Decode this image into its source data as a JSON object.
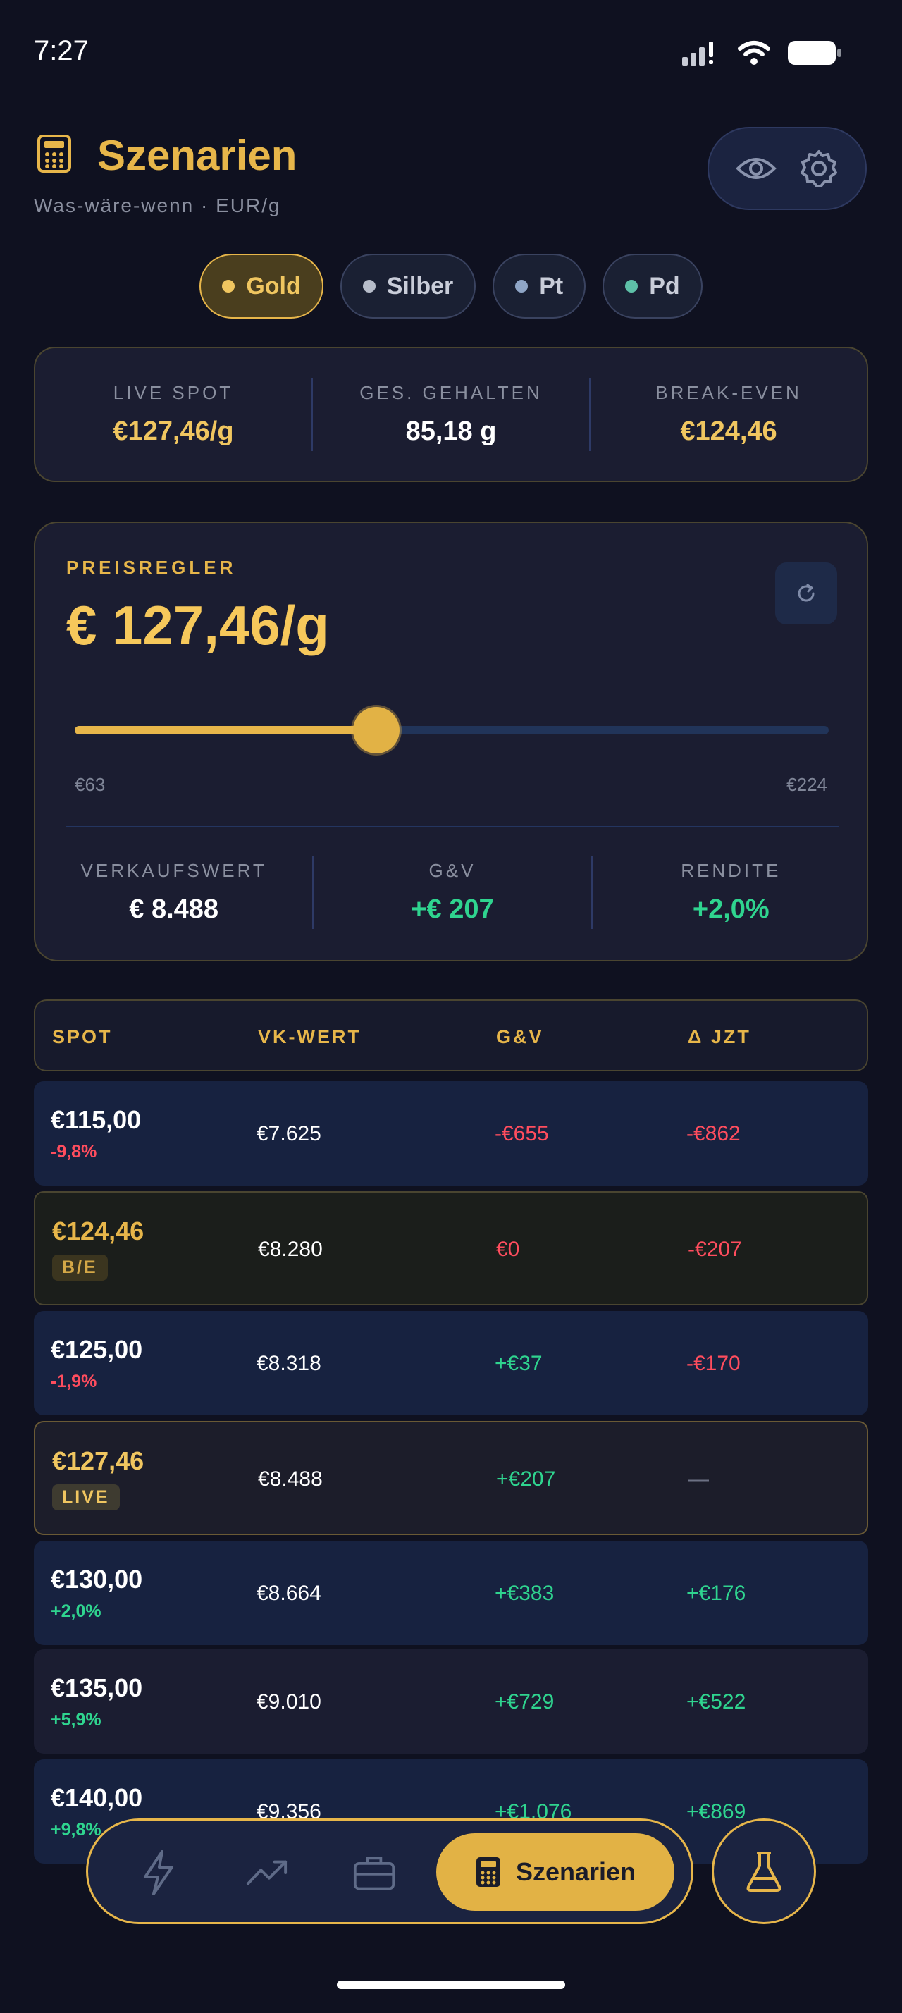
{
  "status": {
    "time": "7:27"
  },
  "header": {
    "title": "Szenarien",
    "subtitle": "Was-wäre-wenn  ·  EUR/g"
  },
  "metals": [
    {
      "label": "Gold",
      "dot": "#f0c660",
      "active": true
    },
    {
      "label": "Silber",
      "dot": "#b7bdca",
      "active": false
    },
    {
      "label": "Pt",
      "dot": "#8fa5c6",
      "active": false
    },
    {
      "label": "Pd",
      "dot": "#5ec0a8",
      "active": false
    }
  ],
  "summary": {
    "spot_label": "LIVE SPOT",
    "spot_value": "€127,46/g",
    "held_label": "GES. GEHALTEN",
    "held_value": "85,18 g",
    "be_label": "BREAK-EVEN",
    "be_value": "€124,46"
  },
  "slider": {
    "label": "PREISREGLER",
    "price": "€ 127,46/g",
    "min_label": "€63",
    "max_label": "€224",
    "position_fraction": 0.4
  },
  "metrics": {
    "sale_label": "VERKAUFSWERT",
    "sale_value": "€ 8.488",
    "pl_label": "G&V",
    "pl_value": "+€ 207",
    "ret_label": "RENDITE",
    "ret_value": "+2,0%"
  },
  "table": {
    "headers": {
      "spot": "SPOT",
      "vk": "VK-WERT",
      "gv": "G&V",
      "jzt": "Δ JZT"
    },
    "rows": [
      {
        "spot": "€115,00",
        "sub": "-9,8%",
        "vk": "€7.625",
        "gv": "-€655",
        "jzt": "-€862"
      },
      {
        "spot": "€124,46",
        "badge": "B/E",
        "vk": "€8.280",
        "gv": "€0",
        "jzt": "-€207"
      },
      {
        "spot": "€125,00",
        "sub": "-1,9%",
        "vk": "€8.318",
        "gv": "+€37",
        "jzt": "-€170"
      },
      {
        "spot": "€127,46",
        "badge": "LIVE",
        "vk": "€8.488",
        "gv": "+€207",
        "jzt": "—"
      },
      {
        "spot": "€130,00",
        "sub": "+2,0%",
        "vk": "€8.664",
        "gv": "+€383",
        "jzt": "+€176"
      },
      {
        "spot": "€135,00",
        "sub": "+5,9%",
        "vk": "€9.010",
        "gv": "+€729",
        "jzt": "+€522"
      },
      {
        "spot": "€140,00",
        "sub": "+9,8%",
        "vk": "€9.356",
        "gv": "+€1.076",
        "jzt": "+€869"
      }
    ]
  },
  "nav": {
    "items": [
      "bolt-icon",
      "trending-icon",
      "briefcase-icon"
    ],
    "active_label": "Szenarien"
  },
  "colors": {
    "accent": "#e7b64a",
    "positive": "#2fd48f",
    "negative": "#ff4d5e",
    "background": "#0f1120"
  }
}
